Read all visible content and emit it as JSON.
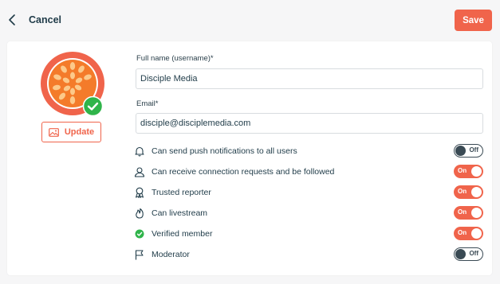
{
  "header": {
    "cancel_label": "Cancel",
    "save_label": "Save"
  },
  "profile": {
    "update_label": "Update",
    "fullname_label": "Full name (username)*",
    "fullname_value": "Disciple Media",
    "email_label": "Email*",
    "email_value": "disciple@disciplemedia.com"
  },
  "permissions": [
    {
      "icon": "bell-icon",
      "label": "Can send push notifications to all users",
      "state": "Off"
    },
    {
      "icon": "user-icon",
      "label": "Can receive connection requests and be followed",
      "state": "On"
    },
    {
      "icon": "award-icon",
      "label": "Trusted reporter",
      "state": "On"
    },
    {
      "icon": "flame-icon",
      "label": "Can livestream",
      "state": "On"
    },
    {
      "icon": "verified-check-icon",
      "label": "Verified member",
      "state": "On"
    },
    {
      "icon": "flag-icon",
      "label": "Moderator",
      "state": "Off"
    }
  ],
  "colors": {
    "accent": "#f0644b",
    "verified": "#2fb44a",
    "text": "#1f3b48"
  }
}
